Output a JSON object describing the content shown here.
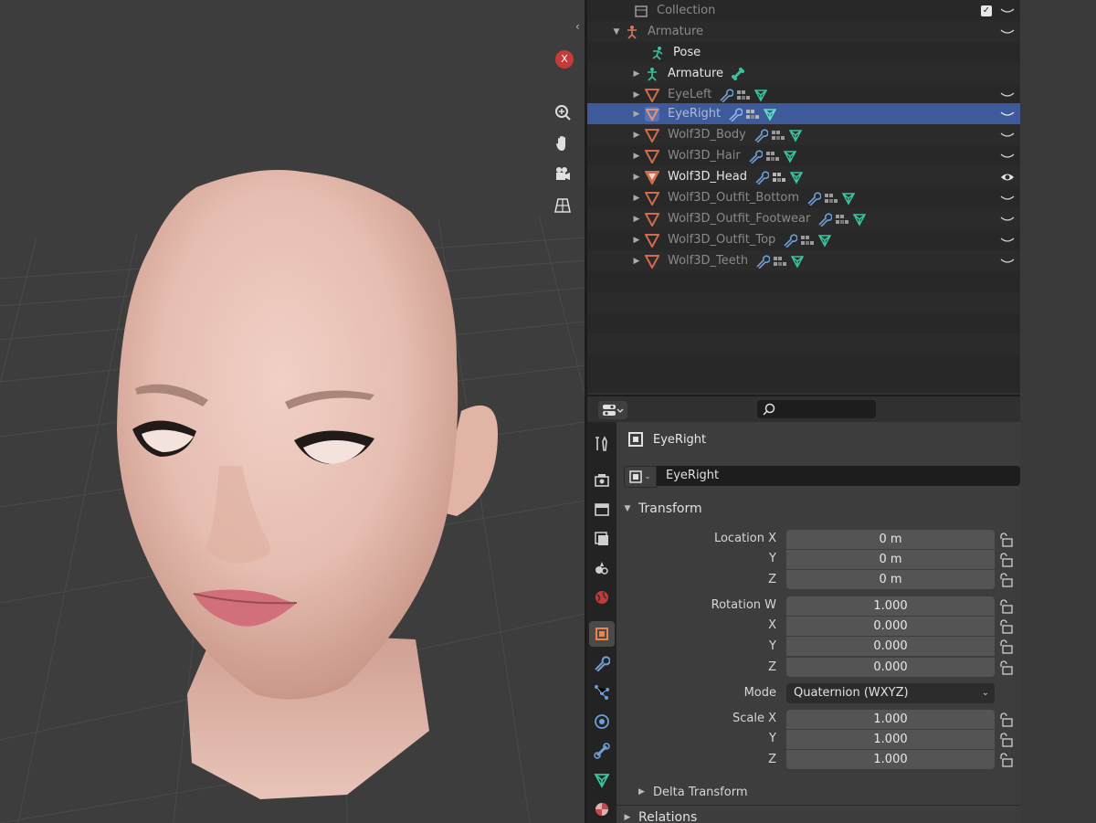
{
  "viewport": {
    "gizmo_x_label": "X",
    "nav_icons": [
      "zoom-icon",
      "pan-hand-icon",
      "camera-icon",
      "grid-perspective-icon"
    ]
  },
  "outliner": {
    "rows": [
      {
        "name": "Collection",
        "type": "collection",
        "indent": 0,
        "dim": true,
        "checkbox": "✓"
      },
      {
        "name": "Armature",
        "type": "armature",
        "indent": 0,
        "dim": true,
        "expanded": true
      },
      {
        "name": "Pose",
        "type": "pose",
        "indent": 1
      },
      {
        "name": "Armature",
        "type": "armature-data",
        "indent": 1,
        "collapsed": true,
        "extra": "bone"
      },
      {
        "name": "EyeLeft",
        "type": "mesh",
        "indent": 1,
        "dim": true,
        "mods": true
      },
      {
        "name": "EyeRight",
        "type": "mesh",
        "indent": 1,
        "dim": true,
        "mods": true,
        "selected": true
      },
      {
        "name": "Wolf3D_Body",
        "type": "mesh",
        "indent": 1,
        "dim": true,
        "mods": true
      },
      {
        "name": "Wolf3D_Hair",
        "type": "mesh",
        "indent": 1,
        "dim": true,
        "mods": true
      },
      {
        "name": "Wolf3D_Head",
        "type": "mesh",
        "indent": 1,
        "bright": true,
        "mods": true,
        "visible": true
      },
      {
        "name": "Wolf3D_Outfit_Bottom",
        "type": "mesh",
        "indent": 1,
        "dim": true,
        "mods": true
      },
      {
        "name": "Wolf3D_Outfit_Footwear",
        "type": "mesh",
        "indent": 1,
        "dim": true,
        "mods": true
      },
      {
        "name": "Wolf3D_Outfit_Top",
        "type": "mesh",
        "indent": 1,
        "dim": true,
        "mods": true
      },
      {
        "name": "Wolf3D_Teeth",
        "type": "mesh",
        "indent": 1,
        "dim": true,
        "mods": true
      }
    ]
  },
  "properties": {
    "object_name": "EyeRight",
    "datablock_name": "EyeRight",
    "transform": {
      "title": "Transform",
      "location_label": "Location X",
      "location": [
        "0 m",
        "0 m",
        "0 m"
      ],
      "rotation_label": "Rotation W",
      "rotation": [
        "1.000",
        "0.000",
        "0.000",
        "0.000"
      ],
      "mode_label": "Mode",
      "mode_value": "Quaternion (WXYZ)",
      "scale_label": "Scale X",
      "scale": [
        "1.000",
        "1.000",
        "1.000"
      ],
      "axis_labels": {
        "x": "X",
        "y": "Y",
        "z": "Z"
      }
    },
    "delta_transform": "Delta Transform",
    "relations": "Relations",
    "tabs": [
      "tool-icon",
      "render-icon",
      "output-icon",
      "view-layer-icon",
      "scene-icon",
      "world-icon",
      "object-icon",
      "modifier-icon",
      "particles-icon",
      "physics-icon",
      "constraints-icon",
      "data-icon",
      "material-icon"
    ]
  },
  "colors": {
    "selection": "#3e5a9a",
    "mesh_icon": "#d06c4c",
    "modifier_icon": "#6f9fd8",
    "data_icon": "#39c2a0",
    "gizmo_x": "#c63a3a"
  }
}
